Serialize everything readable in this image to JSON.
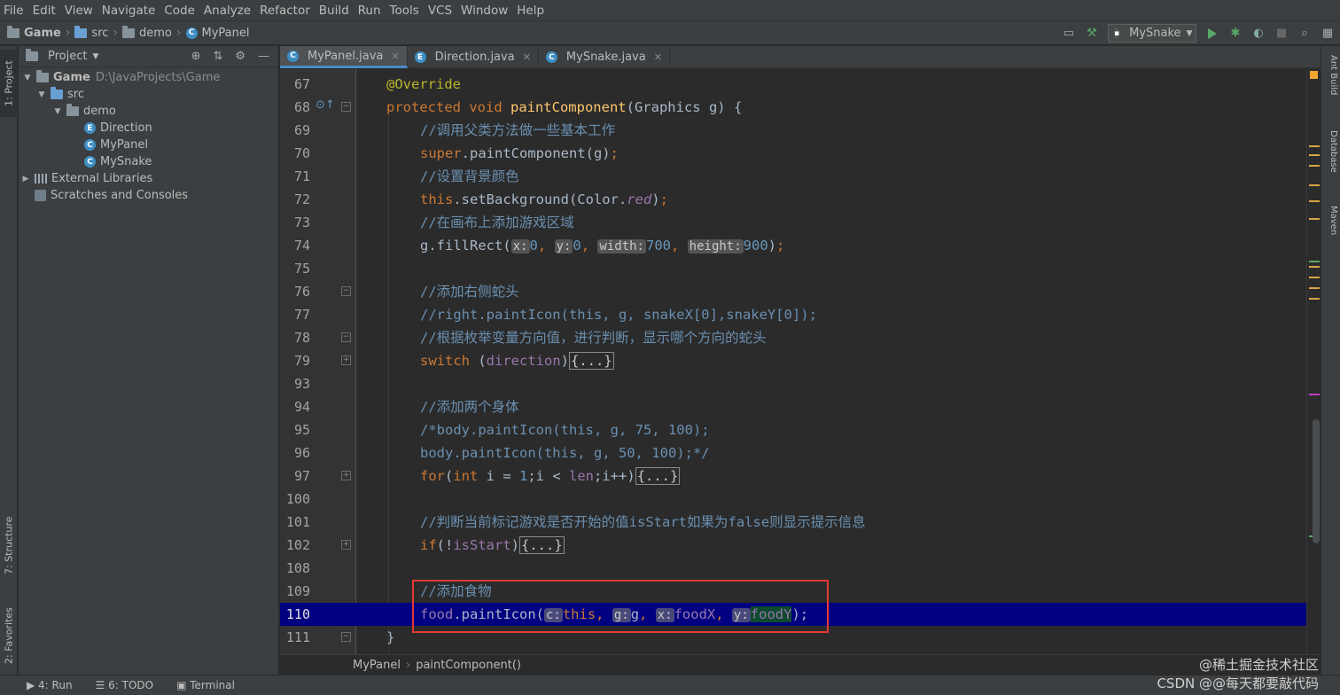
{
  "menu": [
    "File",
    "Edit",
    "View",
    "Navigate",
    "Code",
    "Analyze",
    "Refactor",
    "Build",
    "Run",
    "Tools",
    "VCS",
    "Window",
    "Help"
  ],
  "breadcrumb": {
    "project": "Game",
    "src": "src",
    "pkg": "demo",
    "file": "MyPanel"
  },
  "toolbar": {
    "run_config": "MySnake"
  },
  "left_tabs": {
    "project": "1: Project",
    "structure": "7: Structure",
    "favorites": "2: Favorites"
  },
  "right_tabs": {
    "ant": "Ant Build",
    "database": "Database",
    "maven": "Maven"
  },
  "project_panel": {
    "title": "Project",
    "root": "Game",
    "root_path": "D:\\JavaProjects\\Game",
    "src": "src",
    "pkg": "demo",
    "files": [
      "Direction",
      "MyPanel",
      "MySnake"
    ],
    "ext_libs": "External Libraries",
    "scratches": "Scratches and Consoles"
  },
  "tabs": [
    "MyPanel.java",
    "Direction.java",
    "MySnake.java"
  ],
  "lines": {
    "n67": "67",
    "n68": "68",
    "n69": "69",
    "n70": "70",
    "n71": "71",
    "n72": "72",
    "n73": "73",
    "n74": "74",
    "n75": "75",
    "n76": "76",
    "n77": "77",
    "n78": "78",
    "n79": "79",
    "n93": "93",
    "n94": "94",
    "n95": "95",
    "n96": "96",
    "n97": "97",
    "n100": "100",
    "n101": "101",
    "n102": "102",
    "n108": "108",
    "n109": "109",
    "n110": "110",
    "n111": "111"
  },
  "code": {
    "l67": "@Override",
    "l68_kw": "protected void ",
    "l68_fn": "paintComponent",
    "l68_rest": "(Graphics g) {",
    "l69": "//调用父类方法做一些基本工作",
    "l70_kw": "super",
    "l70_rest": ".paintComponent(g)",
    "l70_semi": ";",
    "l71": "//设置背景颜色",
    "l72_kw": "this",
    "l72_a": ".setBackground(Color.",
    "l72_fld": "red",
    "l72_b": ")",
    "l72_semi": ";",
    "l73": "//在画布上添加游戏区域",
    "l74_a": "g.fillRect(",
    "l74_h1": "x:",
    "l74_v1": "0",
    "l74_h2": "y:",
    "l74_v2": "0",
    "l74_h3": "width:",
    "l74_v3": "700",
    "l74_h4": "height:",
    "l74_v4": "900",
    "l74_end": ")",
    "l74_semi": ";",
    "l76": "//添加右侧蛇头",
    "l77": "//right.paintIcon(this, g, snakeX[0],snakeY[0]);",
    "l78": "//根据枚举变量方向值，进行判断，显示哪个方向的蛇头",
    "l79_kw": "switch ",
    "l79_a": "(",
    "l79_pv": "direction",
    "l79_b": ")",
    "l79_fold": "{...}",
    "l94": "//添加两个身体",
    "l95": "/*body.paintIcon(this, g, 75, 100);",
    "l96": "body.paintIcon(this, g, 50, 100);*/",
    "l97_kw": "for",
    "l97_a": "(",
    "l97_kw2": "int ",
    "l97_b": "i = ",
    "l97_num": "1",
    "l97_c": ";i < ",
    "l97_pv": "len",
    "l97_d": ";i++)",
    "l97_fold": "{...}",
    "l101": "//判断当前标记游戏是否开始的值isStart如果为false则显示提示信息",
    "l102_kw": "if",
    "l102_a": "(!",
    "l102_pv": "isStart",
    "l102_b": ")",
    "l102_fold": "{...}",
    "l109": "//添加食物",
    "l110_pv": "food",
    "l110_a": ".paintIcon(",
    "l110_h1": "c:",
    "l110_kw": "this",
    "l110_s1": ", ",
    "l110_h2": "g:",
    "l110_g": "g",
    "l110_s2": ", ",
    "l110_h3": "x:",
    "l110_pv2": "foodX",
    "l110_s3": ", ",
    "l110_h4": "y:",
    "l110_pv3": "foodY",
    "l110_end": ");",
    "l111": "}"
  },
  "editor_breadcrumb": {
    "cls": "MyPanel",
    "method": "paintComponent()"
  },
  "status": {
    "run": "4: Run",
    "todo": "6: TODO",
    "terminal": "Terminal"
  },
  "watermark": {
    "line1": "@稀土掘金技术社区",
    "line2": "CSDN @@每天都要敲代码"
  },
  "colors": {
    "accent": "#4a88c7",
    "current_line": "#000080",
    "highlight_box": "#e53935"
  }
}
